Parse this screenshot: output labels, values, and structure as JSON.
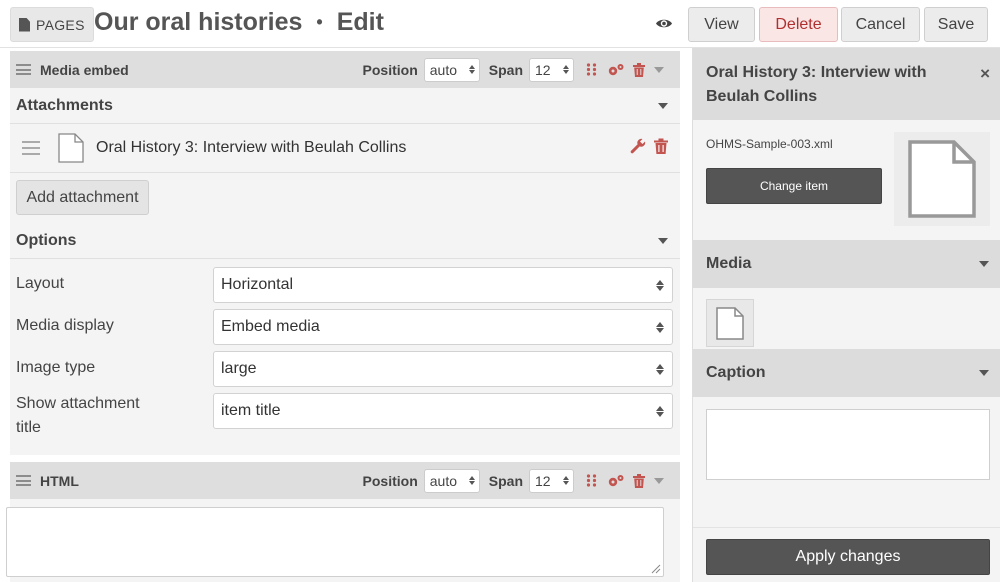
{
  "header": {
    "pages_label": "PAGES",
    "title": "Our oral histories",
    "separator": "•",
    "mode": "Edit",
    "buttons": {
      "view": "View",
      "delete": "Delete",
      "cancel": "Cancel",
      "save": "Save"
    }
  },
  "media_block": {
    "title": "Media embed",
    "position_label": "Position",
    "position_value": "auto",
    "span_label": "Span",
    "span_value": "12",
    "attachments_title": "Attachments",
    "attachment": {
      "title": "Oral History 3: Interview with Beulah Collins"
    },
    "add_attachment_label": "Add attachment",
    "options_title": "Options",
    "options": [
      {
        "label": "Layout",
        "value": "Horizontal"
      },
      {
        "label": "Media display",
        "value": "Embed media"
      },
      {
        "label": "Image type",
        "value": "large"
      },
      {
        "label": "Show attachment title",
        "value": "item title"
      }
    ]
  },
  "html_block": {
    "title": "HTML",
    "position_label": "Position",
    "position_value": "auto",
    "span_label": "Span",
    "span_value": "12"
  },
  "side_panel": {
    "title": "Oral History 3: Interview with Beulah Collins",
    "close_glyph": "×",
    "file_name": "OHMS-Sample-003.xml",
    "change_item_label": "Change item",
    "media_title": "Media",
    "caption_title": "Caption",
    "apply_label": "Apply changes"
  },
  "colors": {
    "delete_text": "#b03030",
    "icon_red": "#c25550",
    "dark_button": "#555555"
  }
}
